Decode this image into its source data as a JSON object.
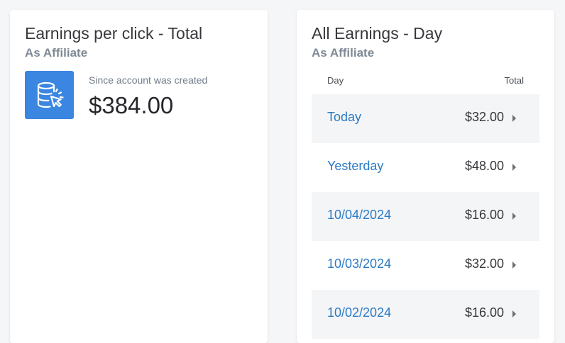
{
  "left_card": {
    "title": "Earnings per click - Total",
    "subtitle": "As Affiliate",
    "icon": "database-click-icon",
    "since_label": "Since account was created",
    "value": "$384.00"
  },
  "right_card": {
    "title": "All Earnings - Day",
    "subtitle": "As Affiliate",
    "columns": {
      "day": "Day",
      "total": "Total"
    },
    "rows": [
      {
        "day": "Today",
        "total": "$32.00"
      },
      {
        "day": "Yesterday",
        "total": "$48.00"
      },
      {
        "day": "10/04/2024",
        "total": "$16.00"
      },
      {
        "day": "10/03/2024",
        "total": "$32.00"
      },
      {
        "day": "10/02/2024",
        "total": "$16.00"
      }
    ]
  },
  "colors": {
    "accent": "#3a86e0",
    "link": "#2c7bc6",
    "subtitle": "#7f8b96"
  }
}
